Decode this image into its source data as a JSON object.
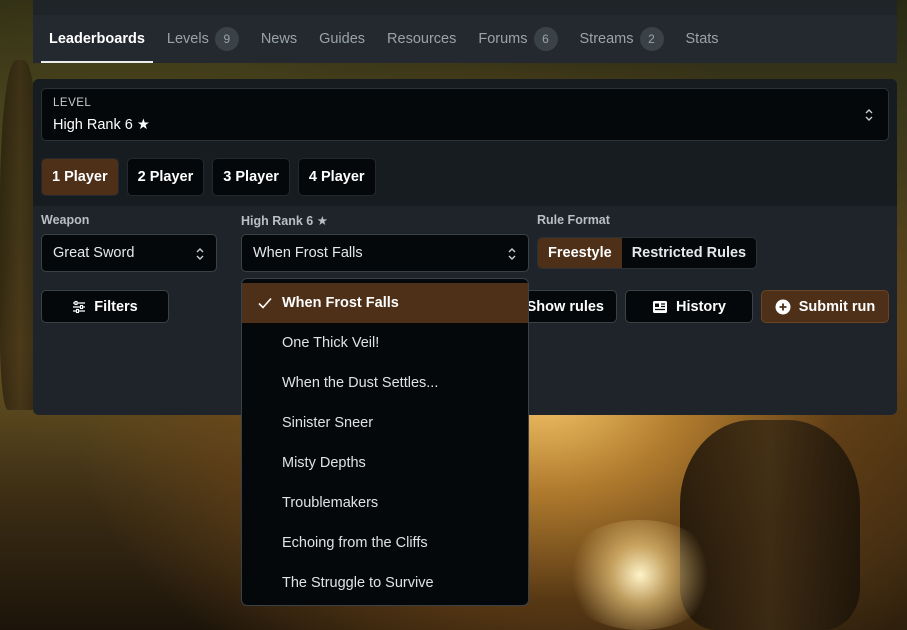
{
  "nav": {
    "items": [
      {
        "label": "Leaderboards",
        "badge": null,
        "active": true
      },
      {
        "label": "Levels",
        "badge": "9"
      },
      {
        "label": "News",
        "badge": null
      },
      {
        "label": "Guides",
        "badge": null
      },
      {
        "label": "Resources",
        "badge": null
      },
      {
        "label": "Forums",
        "badge": "6"
      },
      {
        "label": "Streams",
        "badge": "2"
      },
      {
        "label": "Stats",
        "badge": null
      }
    ]
  },
  "level": {
    "label": "LEVEL",
    "value": "High Rank 6 ★"
  },
  "players": [
    "1 Player",
    "2 Player",
    "3 Player",
    "4 Player"
  ],
  "filters": {
    "weapon_label": "Weapon",
    "weapon_value": "Great Sword",
    "quest_label": "High Rank 6 ★",
    "quest_value": "When Frost Falls",
    "rule_label": "Rule Format",
    "rule_options": [
      "Freestyle",
      "Restricted Rules"
    ]
  },
  "actions": {
    "filters": "Filters",
    "show_rules": "Show rules",
    "history": "History",
    "submit": "Submit run"
  },
  "dropdown": {
    "options": [
      "When Frost Falls",
      "One Thick Veil!",
      "When the Dust Settles...",
      "Sinister Sneer",
      "Misty Depths",
      "Troublemakers",
      "Echoing from the Cliffs",
      "The Struggle to Survive"
    ],
    "selected": "When Frost Falls"
  },
  "colors": {
    "accent": "#4e2f17",
    "surface": "#05080a",
    "panel": "#1e2429"
  }
}
